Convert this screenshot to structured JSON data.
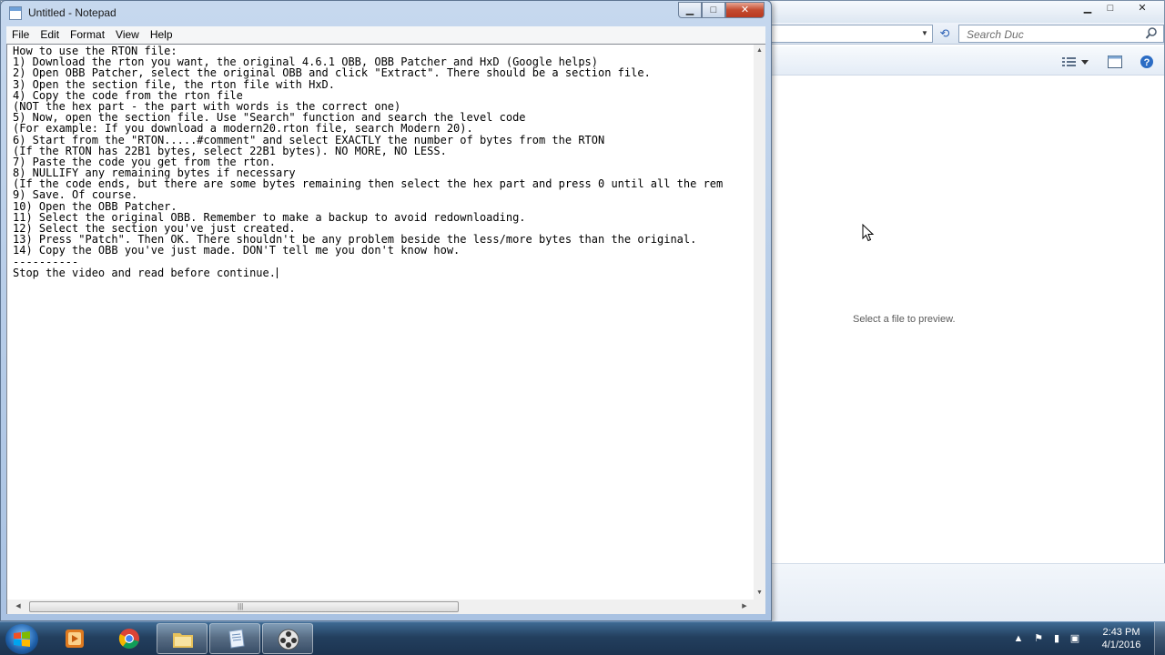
{
  "notepad": {
    "title": "Untitled - Notepad",
    "controls": {
      "minimize": "▁",
      "maximize": "□",
      "close": "✕"
    },
    "menu": [
      "File",
      "Edit",
      "Format",
      "View",
      "Help"
    ],
    "lines": [
      "How to use the RTON file:",
      "1) Download the rton you want, the original 4.6.1 OBB, OBB Patcher and HxD (Google helps)",
      "2) Open OBB Patcher, select the original OBB and click \"Extract\". There should be a section file.",
      "3) Open the section file, the rton file with HxD.",
      "4) Copy the code from the rton file",
      "(NOT the hex part - the part with words is the correct one)",
      "5) Now, open the section file. Use \"Search\" function and search the level code",
      "(For example: If you download a modern20.rton file, search Modern 20).",
      "6) Start from the \"RTON.....#comment\" and select EXACTLY the number of bytes from the RTON",
      "(If the RTON has 22B1 bytes, select 22B1 bytes). NO MORE, NO LESS.",
      "7) Paste the code you get from the rton.",
      "8) NULLIFY any remaining bytes if necessary",
      "(If the code ends, but there are some bytes remaining then select the hex part and press 0 until all the rem",
      "9) Save. Of course.",
      "10) Open the OBB Patcher.",
      "11) Select the original OBB. Remember to make a backup to avoid redownloading.",
      "12) Select the section you've just created.",
      "13) Press \"Patch\". Then OK. There shouldn't be any problem beside the less/more bytes than the original.",
      "14) Copy the OBB you've just made. DON'T tell me you don't know how.",
      "----------",
      "Stop the video and read before continue."
    ],
    "hscroll_grip": "|||"
  },
  "explorer": {
    "search_placeholder": "Search Duc",
    "preview_text": "Select a file to preview.",
    "controls": {
      "minimize": "▁",
      "maximize": "□",
      "close": "✕"
    }
  },
  "taskbar": {
    "time": "2:43 PM",
    "date": "4/1/2016",
    "apps": [
      "media-player-icon",
      "chrome-icon",
      "explorer-folder-icon",
      "notepad-icon",
      "video-editor-icon"
    ]
  },
  "colors": {
    "taskbar": "#233f5e",
    "close_button": "#c44a2f",
    "window_frame": "#a9c2e2"
  }
}
